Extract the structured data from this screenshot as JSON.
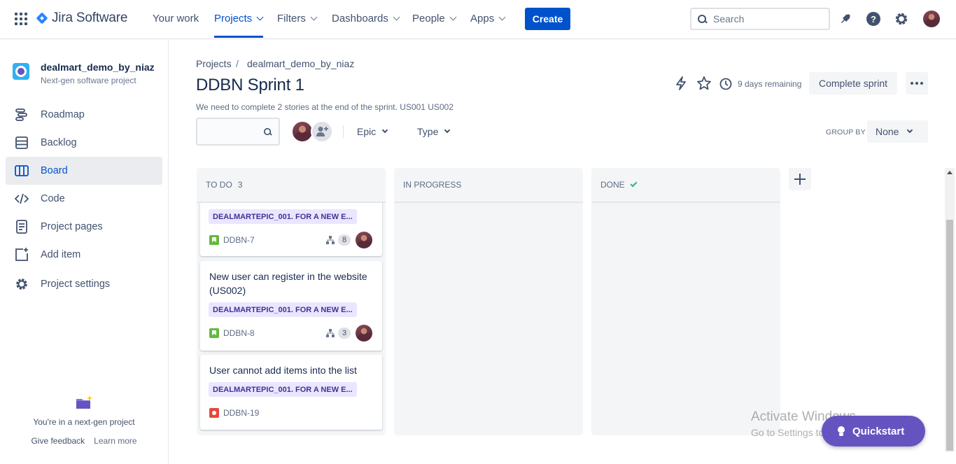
{
  "topnav": {
    "product": "Jira Software",
    "items": [
      {
        "label": "Your work",
        "dropdown": false
      },
      {
        "label": "Projects",
        "dropdown": true,
        "active": true
      },
      {
        "label": "Filters",
        "dropdown": true
      },
      {
        "label": "Dashboards",
        "dropdown": true
      },
      {
        "label": "People",
        "dropdown": true
      },
      {
        "label": "Apps",
        "dropdown": true
      }
    ],
    "create_label": "Create",
    "search_placeholder": "Search",
    "icons": [
      "apps-grid-icon",
      "jira-logo-icon",
      "notifications-icon",
      "help-icon",
      "settings-icon",
      "profile-avatar"
    ]
  },
  "sidebar": {
    "project_name": "dealmart_demo_by_niaz",
    "project_type": "Next-gen software project",
    "items": [
      {
        "label": "Roadmap",
        "icon": "roadmap-icon"
      },
      {
        "label": "Backlog",
        "icon": "backlog-icon"
      },
      {
        "label": "Board",
        "icon": "board-icon",
        "active": true
      },
      {
        "label": "Code",
        "icon": "code-icon"
      },
      {
        "label": "Project pages",
        "icon": "pages-icon"
      },
      {
        "label": "Add item",
        "icon": "add-item-icon"
      },
      {
        "label": "Project settings",
        "icon": "settings-icon"
      }
    ],
    "footer_text": "You're in a next-gen project",
    "give_feedback": "Give feedback",
    "learn_more": "Learn more"
  },
  "header": {
    "breadcrumb": [
      "Projects",
      "dealmart_demo_by_niaz"
    ],
    "breadcrumb_separator": "/",
    "title": "DDBN Sprint 1",
    "goal": "We need to complete 2 stories at the end of the sprint. US001 US002",
    "days_remaining": "9 days remaining",
    "complete_sprint_label": "Complete sprint"
  },
  "filters": {
    "search_value": "",
    "epic_label": "Epic",
    "type_label": "Type",
    "group_by_label": "GROUP BY",
    "group_by_value": "None"
  },
  "board": {
    "columns": [
      {
        "name": "TO DO",
        "count": "3"
      },
      {
        "name": "IN PROGRESS",
        "count": ""
      },
      {
        "name": "DONE",
        "count": "",
        "done_check": true
      }
    ],
    "todo_cards": [
      {
        "title": "",
        "epic": "DEALMARTEPIC_001. FOR A NEW E...",
        "type": "story",
        "key": "DDBN-7",
        "subtasks": "8",
        "assignee": true
      },
      {
        "title": "New user can register in the website (US002)",
        "epic": "DEALMARTEPIC_001. FOR A NEW E...",
        "type": "story",
        "key": "DDBN-8",
        "subtasks": "3",
        "assignee": true
      },
      {
        "title": "User cannot add items into the list",
        "epic": "DEALMARTEPIC_001. FOR A NEW E...",
        "type": "bug",
        "key": "DDBN-19",
        "subtasks": "",
        "assignee": false
      }
    ]
  },
  "overlay": {
    "watermark_title": "Activate Windows",
    "watermark_sub": "Go to Settings to activate Windows.",
    "quickstart_label": "Quickstart"
  },
  "colors": {
    "brand_blue": "#0052cc",
    "epic_bg": "#eae6ff",
    "epic_text": "#403294",
    "story_green": "#63ba3c",
    "bug_red": "#e5493a",
    "quickstart_purple": "#6554c0"
  }
}
